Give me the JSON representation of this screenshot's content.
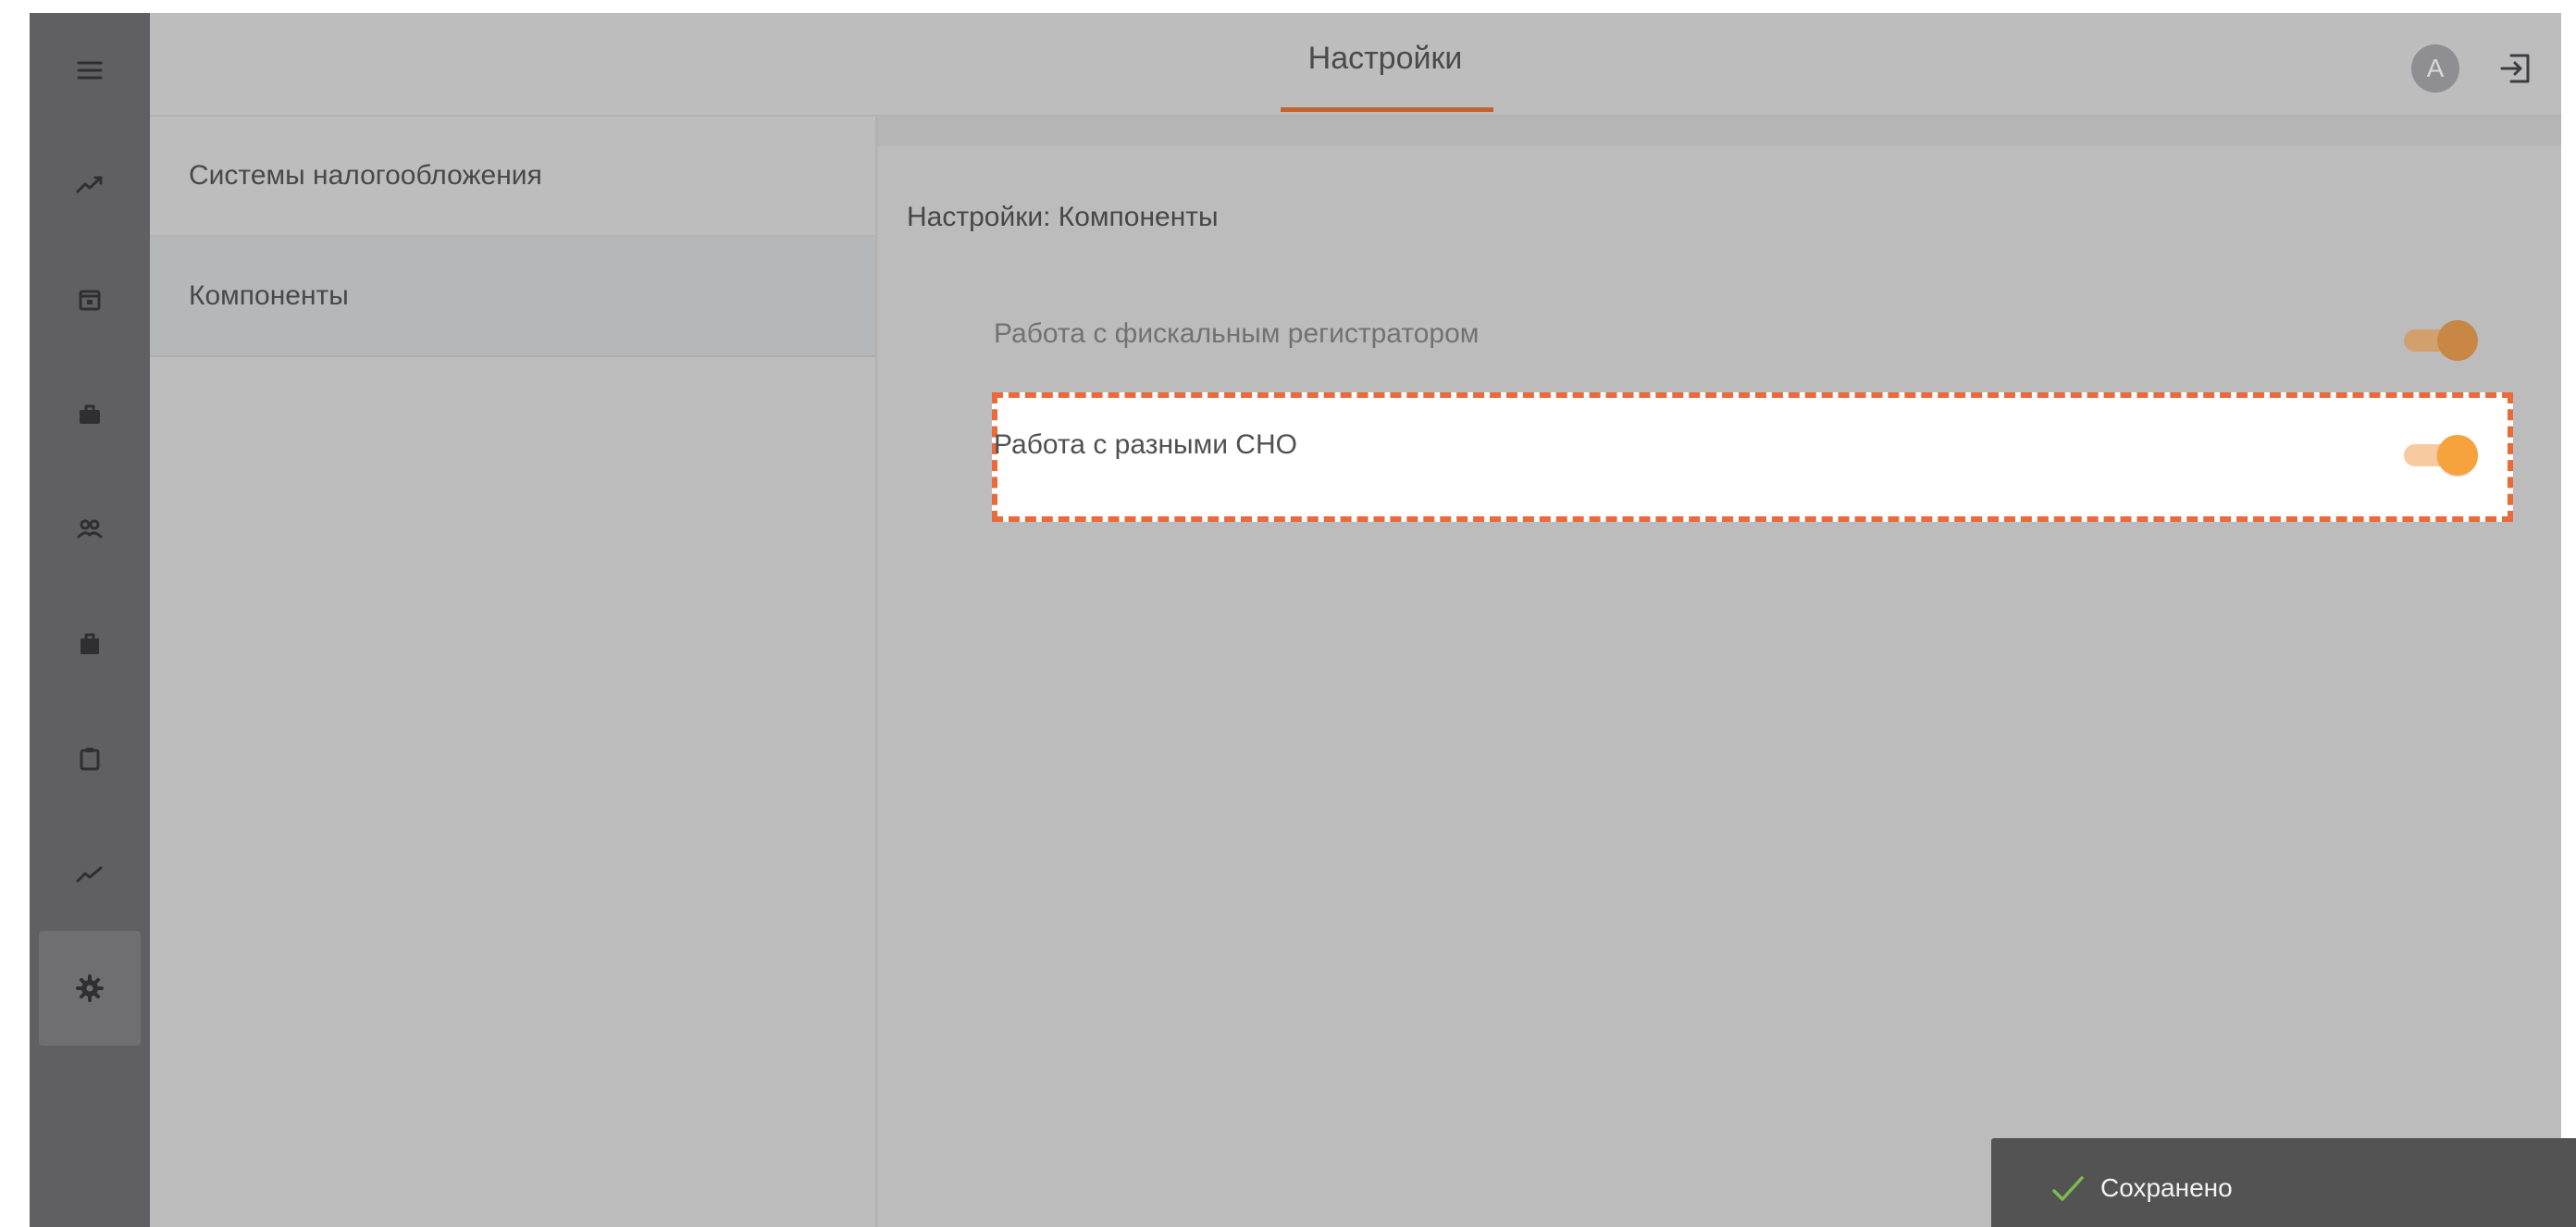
{
  "header": {
    "title": "Настройки",
    "avatar_initial": "A",
    "accent_color": "#c4632f"
  },
  "rail": {
    "items": [
      {
        "icon": "menu-icon"
      },
      {
        "icon": "trending-up-icon"
      },
      {
        "icon": "calendar-icon"
      },
      {
        "icon": "briefcase-icon"
      },
      {
        "icon": "users-icon"
      },
      {
        "icon": "shop-bag-icon"
      },
      {
        "icon": "clipboard-icon"
      },
      {
        "icon": "chart-line-icon"
      },
      {
        "icon": "gear-icon",
        "active": true
      }
    ]
  },
  "left_menu": {
    "items": [
      {
        "label": "Системы налогообложения"
      },
      {
        "label": "Компоненты",
        "selected": true
      }
    ]
  },
  "content": {
    "section_title": "Настройки: Компоненты",
    "settings": [
      {
        "label": "Работа с фискальным регистратором",
        "enabled": true
      },
      {
        "label": "Работа с разными СНО",
        "enabled": true,
        "highlighted": true
      }
    ],
    "highlight_color": "#ea6a3b",
    "toggle_color": "#f7a33d"
  },
  "toast": {
    "text": "Сохранено",
    "icon": "check-icon",
    "check_color": "#7dbb4e"
  }
}
